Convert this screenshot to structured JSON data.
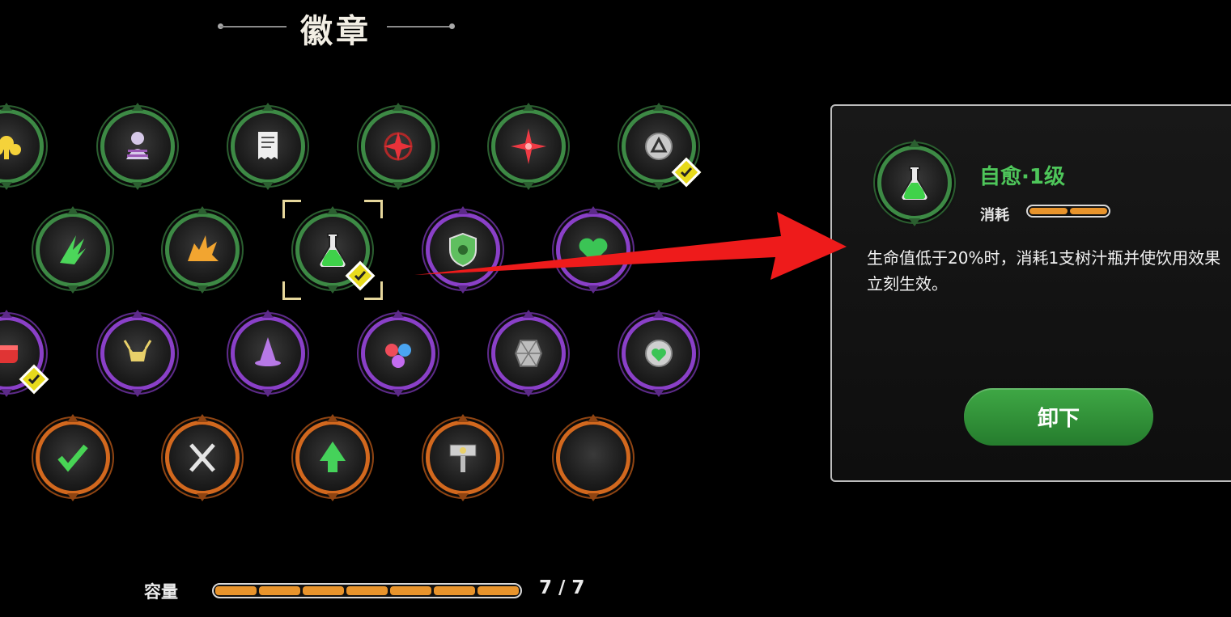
{
  "header": {
    "title": "徽章"
  },
  "badges": [
    {
      "name": "badge-yellow-splash",
      "color": "green",
      "icon": "yellow-splash-icon",
      "equipped": false
    },
    {
      "name": "badge-hooded-figure",
      "color": "green",
      "icon": "hooded-figure-icon",
      "equipped": false
    },
    {
      "name": "badge-receipt",
      "color": "green",
      "icon": "receipt-icon",
      "equipped": false
    },
    {
      "name": "badge-red-crosshair-star",
      "color": "green",
      "icon": "red-crosshair-star-icon",
      "equipped": false
    },
    {
      "name": "badge-red-star",
      "color": "green",
      "icon": "red-star-icon",
      "equipped": false
    },
    {
      "name": "badge-triangle-coin",
      "color": "green",
      "icon": "triangle-coin-icon",
      "equipped": true
    },
    {
      "name": "badge-green-claw",
      "color": "green",
      "icon": "green-claw-icon",
      "equipped": false
    },
    {
      "name": "badge-explosion",
      "color": "green",
      "icon": "explosion-icon",
      "equipped": false
    },
    {
      "name": "badge-potion-flask",
      "color": "green",
      "icon": "potion-flask-icon",
      "equipped": true,
      "selected": true
    },
    {
      "name": "badge-shield",
      "color": "purple",
      "icon": "shield-icon",
      "equipped": false
    },
    {
      "name": "badge-heart",
      "color": "purple",
      "icon": "heart-icon",
      "equipped": false
    },
    {
      "name": "badge-red-fist",
      "color": "purple",
      "icon": "red-fist-icon",
      "equipped": true
    },
    {
      "name": "badge-horned-helmet",
      "color": "purple",
      "icon": "horned-helmet-icon",
      "equipped": false
    },
    {
      "name": "badge-witch-hat",
      "color": "purple",
      "icon": "witch-hat-icon",
      "equipped": false
    },
    {
      "name": "badge-swirl",
      "color": "purple",
      "icon": "swirl-icon",
      "equipped": false
    },
    {
      "name": "badge-crystal",
      "color": "purple",
      "icon": "crystal-icon",
      "equipped": false
    },
    {
      "name": "badge-heart-coin",
      "color": "purple",
      "icon": "heart-coin-icon",
      "equipped": false
    },
    {
      "name": "badge-check-arrow",
      "color": "orange",
      "icon": "check-arrow-icon",
      "equipped": false
    },
    {
      "name": "badge-crossed-knives",
      "color": "orange",
      "icon": "crossed-knives-icon",
      "equipped": false
    },
    {
      "name": "badge-green-arrow",
      "color": "orange",
      "icon": "green-arrow-icon",
      "equipped": false
    },
    {
      "name": "badge-hammer",
      "color": "orange",
      "icon": "hammer-icon",
      "equipped": false
    },
    {
      "name": "badge-red-crescent",
      "color": "orange",
      "icon": "red-crescent-icon",
      "equipped": false
    }
  ],
  "detail": {
    "title": "自愈·1级",
    "cost_label": "消耗",
    "cost_segments": 2,
    "description": "生命值低于20%时，消耗1支树汁瓶并使饮用效果立刻生效。",
    "button_label": "卸下",
    "accent_color": "#4ec65a"
  },
  "capacity": {
    "label": "容量",
    "used": 7,
    "max": 7,
    "text": "7 / 7"
  }
}
